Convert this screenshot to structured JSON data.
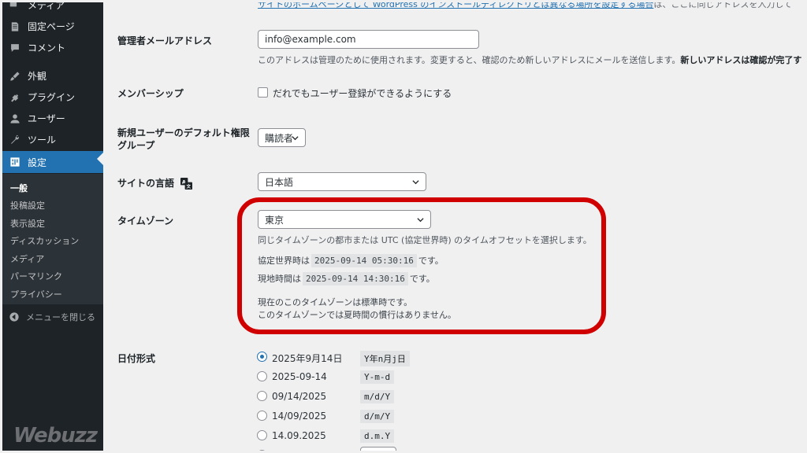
{
  "sidebar": {
    "items": [
      {
        "label": "メディア",
        "icon": "media-icon"
      },
      {
        "label": "固定ページ",
        "icon": "page-icon"
      },
      {
        "label": "コメント",
        "icon": "comment-icon"
      },
      {
        "label": "外観",
        "icon": "appearance-icon"
      },
      {
        "label": "プラグイン",
        "icon": "plugin-icon"
      },
      {
        "label": "ユーザー",
        "icon": "user-icon"
      },
      {
        "label": "ツール",
        "icon": "tool-icon"
      },
      {
        "label": "設定",
        "icon": "settings-icon",
        "active": true
      }
    ],
    "submenu": [
      "一般",
      "投稿設定",
      "表示設定",
      "ディスカッション",
      "メディア",
      "パーマリンク",
      "プライバシー"
    ],
    "collapse_label": "メニューを閉じる"
  },
  "watermark": "Webuzz",
  "top_note": {
    "link": "サイトのホームページとして WordPress のインストールディレクトリとは異なる場所を設定する場合",
    "rest": "は、ここに同じアドレスを入力して"
  },
  "admin_email": {
    "label": "管理者メールアドレス",
    "value": "info@example.com",
    "desc": "このアドレスは管理のために使用されます。変更すると、確認のため新しいアドレスにメールを送信します。",
    "desc_bold": "新しいアドレスは確認が完了す"
  },
  "membership": {
    "label": "メンバーシップ",
    "checkbox_label": "だれでもユーザー登録ができるようにする"
  },
  "default_role": {
    "label_line1": "新規ユーザーのデフォルト権限",
    "label_line2": "グループ",
    "value": "購読者"
  },
  "site_language": {
    "label": "サイトの言語",
    "value": "日本語"
  },
  "timezone": {
    "label": "タイムゾーン",
    "value": "東京",
    "desc": "同じタイムゾーンの都市または UTC (協定世界時) のタイムオフセットを選択します。",
    "utc_prefix": "協定世界時は",
    "utc_time": "2025-09-14 05:30:16",
    "utc_suffix": "です。",
    "local_prefix": "現地時間は",
    "local_time": "2025-09-14 14:30:16",
    "local_suffix": "です。",
    "note1": "現在のこのタイムゾーンは標準時です。",
    "note2": "このタイムゾーンでは夏時間の慣行はありません。"
  },
  "date_format": {
    "label": "日付形式",
    "options": [
      {
        "label": "2025年9月14日",
        "code": "Y年n月j日",
        "checked": true
      },
      {
        "label": "2025-09-14",
        "code": "Y-m-d",
        "checked": false
      },
      {
        "label": "09/14/2025",
        "code": "m/d/Y",
        "checked": false
      },
      {
        "label": "14/09/2025",
        "code": "d/m/Y",
        "checked": false
      },
      {
        "label": "14.09.2025",
        "code": "d.m.Y",
        "checked": false
      }
    ]
  },
  "colors": {
    "sidebar_bg": "#1d2327",
    "active_bg": "#2271b1",
    "highlight_border": "#d10000"
  }
}
